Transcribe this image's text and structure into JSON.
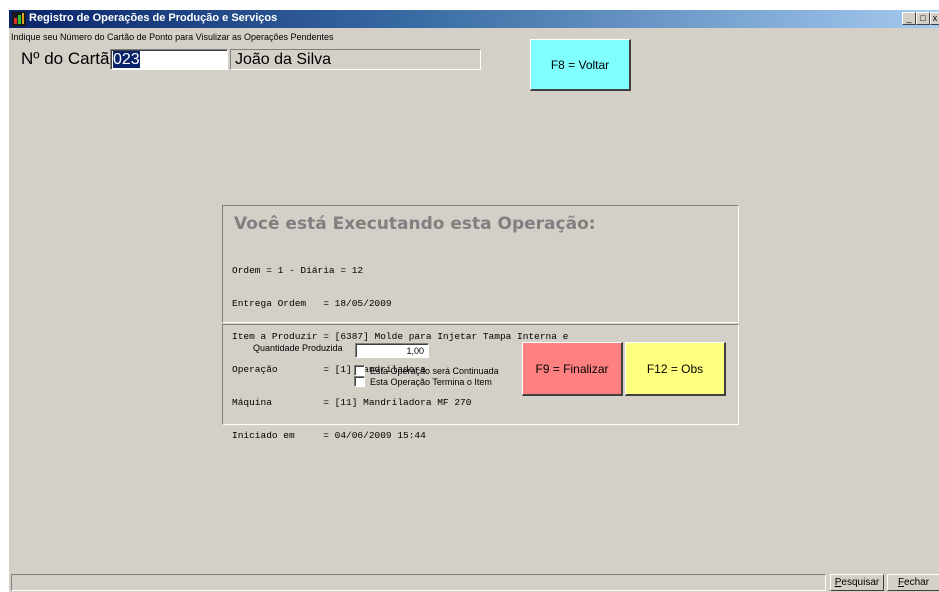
{
  "window": {
    "title": "Registro de Operações de Produção e Serviços",
    "controls": {
      "minimize": "_",
      "maximize": "□",
      "close": "x"
    }
  },
  "header": {
    "instruction": "Indique seu Número do Cartão de Ponto para Visulizar as Operações Pendentes",
    "card_label": "Nº do Cartão",
    "card_number": "023",
    "employee_name": "João da Silva"
  },
  "buttons": {
    "back": "F8 = Voltar",
    "finish": "F9 = Finalizar",
    "obs": "F12 = Obs"
  },
  "operation": {
    "heading": "Você está Executando esta Operação:",
    "lines": [
      "Ordem = 1 - Diária = 12",
      "Entrega Ordem   = 18/05/2009",
      "Item a Produzir = [6387] Molde para Injetar Tampa Interna e",
      "Operação        = [1] Mandriladora",
      "Máquina         = [11] Mandriladora MF 270",
      "Iniciado em     = 04/06/2009 15:44"
    ]
  },
  "production": {
    "quantity_label": "Quantidade Produzida",
    "quantity_value": "1,00",
    "continue_label": "Esta Operação será Continuada",
    "continue_checked": false,
    "ends_item_label": "Esta Operação Termina o Item",
    "ends_item_checked": false
  },
  "statusbar": {
    "search_prefix": "P",
    "search_rest": "esquisar",
    "close_prefix": "F",
    "close_rest": "echar"
  },
  "colors": {
    "window_bg": "#d4d0c8",
    "titlebar": "#0a246a",
    "back_button": "#80ffff",
    "finish_button": "#ff8080",
    "obs_button": "#ffff80"
  }
}
